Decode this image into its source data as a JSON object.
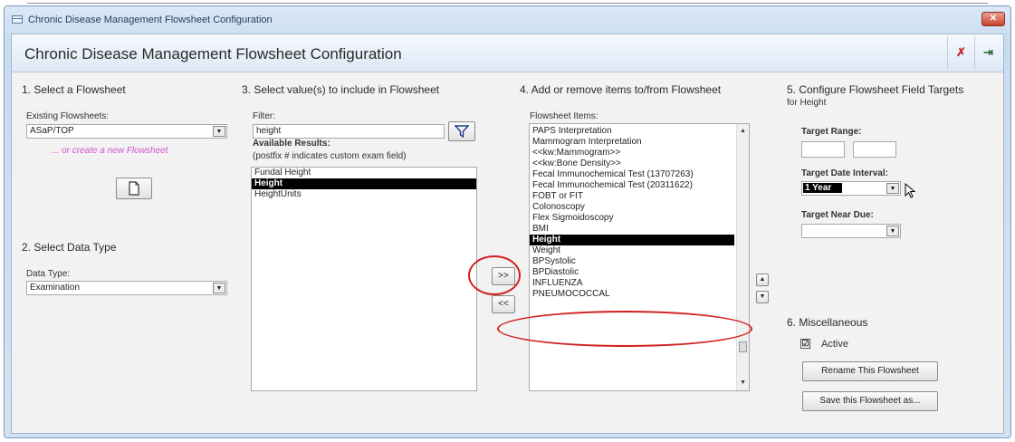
{
  "window": {
    "title": "Chronic Disease Management Flowsheet Configuration",
    "close_glyph": "✕"
  },
  "header": {
    "heading": "Chronic Disease Management Flowsheet Configuration",
    "undo_glyph": "✗",
    "exit_glyph": "⇥"
  },
  "section1": {
    "title": "1. Select a  Flowsheet",
    "existing_label": "Existing Flowsheets:",
    "existing_value": "ASaP/TOP",
    "create_text": "... or create a new  Flowsheet"
  },
  "section2": {
    "title": "2. Select Data Type",
    "data_type_label": "Data Type:",
    "data_type_value": "Examination"
  },
  "section3": {
    "title": "3. Select value(s) to include in Flowsheet",
    "filter_label": "Filter:",
    "filter_value": "height",
    "available_label": "Available Results:",
    "postfix_note": "(postfix # indicates custom exam field)",
    "results": [
      {
        "label": "Fundal Height",
        "selected": false
      },
      {
        "label": "Height",
        "selected": true
      },
      {
        "label": "HeightUnits",
        "selected": false
      }
    ]
  },
  "transfer": {
    "add_label": ">>",
    "remove_label": "<<"
  },
  "section4": {
    "title": "4. Add or remove items to/from Flowsheet",
    "items_label": "Flowsheet Items:",
    "items": [
      {
        "label": "PAPS Interpretation",
        "selected": false
      },
      {
        "label": "Mammogram Interpretation",
        "selected": false
      },
      {
        "label": "<<kw:Mammogram>>",
        "selected": false
      },
      {
        "label": "<<kw:Bone Density>>",
        "selected": false
      },
      {
        "label": "Fecal Immunochemical Test (13707263)",
        "selected": false
      },
      {
        "label": "Fecal Immunochemical Test (20311622)",
        "selected": false
      },
      {
        "label": "FOBT or FIT",
        "selected": false
      },
      {
        "label": "Colonoscopy",
        "selected": false
      },
      {
        "label": "Flex Sigmoidoscopy",
        "selected": false
      },
      {
        "label": "BMI",
        "selected": false
      },
      {
        "label": "Height",
        "selected": true
      },
      {
        "label": "Weight",
        "selected": false
      },
      {
        "label": "BPSystolic",
        "selected": false
      },
      {
        "label": "BPDiastolic",
        "selected": false
      },
      {
        "label": "INFLUENZA",
        "selected": false
      },
      {
        "label": "PNEUMOCOCCAL",
        "selected": false
      }
    ],
    "move_up_glyph": "▲",
    "move_down_glyph": "▼"
  },
  "section5": {
    "title": "5. Configure Flowsheet Field Targets",
    "subtitle": "for Height",
    "target_range_label": "Target Range:",
    "target_date_label": "Target Date Interval:",
    "target_date_value": "1 Year",
    "target_near_label": "Target Near Due:",
    "target_near_value": ""
  },
  "section6": {
    "title": "6. Miscellaneous",
    "active_label": "Active",
    "active_checked": "☑",
    "rename_label": "Rename This Flowsheet",
    "save_as_label": "Save this Flowsheet as..."
  },
  "colors": {
    "annotation_red": "#d21f1f",
    "selection_bg": "#000000"
  }
}
